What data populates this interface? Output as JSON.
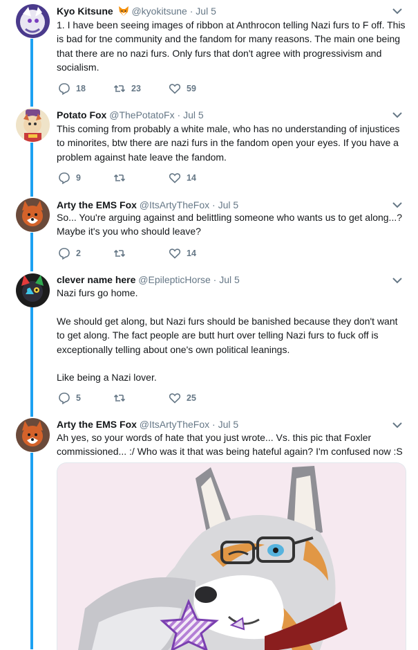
{
  "thread_color": "#1da1f2",
  "tweets": [
    {
      "name": "Kyo Kitsune",
      "name_emoji": "fox-face-emoji",
      "handle": "@kyokitsune",
      "date": "Jul 5",
      "body": [
        "1. I have been seeing images of ribbon at Anthrocon telling Nazi furs to F off. This is bad for tne community and the fandom for many reasons. The main one being that there are no nazi furs. Only furs that don't agree with progressivism and socialism."
      ],
      "replies": "18",
      "retweets": "23",
      "likes": "59"
    },
    {
      "name": "Potato Fox",
      "handle": "@ThePotatoFx",
      "date": "Jul 5",
      "body": [
        "This coming from probably a white male, who has no understanding of injustices to minorites, btw there are nazi furs in the fandom open your eyes. If you have a problem against hate leave the fandom."
      ],
      "replies": "9",
      "retweets": "",
      "likes": "14"
    },
    {
      "name": "Arty the EMS Fox",
      "handle": "@ItsArtyTheFox",
      "date": "Jul 5",
      "body": [
        "So... You're arguing against and belittling someone who wants us to get along...? Maybe it's you who should leave?"
      ],
      "replies": "2",
      "retweets": "",
      "likes": "14"
    },
    {
      "name": "clever name here",
      "handle": "@EpilepticHorse",
      "date": "Jul 5",
      "body": [
        "Nazi furs go home.",
        "We should get along, but Nazi furs should be banished because they don't want to get along. The fact people are butt hurt over telling Nazi furs to fuck off is exceptionally telling about one's own political leanings.",
        "Like being a Nazi lover."
      ],
      "replies": "5",
      "retweets": "",
      "likes": "25"
    },
    {
      "name": "Arty the EMS Fox",
      "handle": "@ItsArtyTheFox",
      "date": "Jul 5",
      "body": [
        "Ah yes, so your words of hate that you just wrote... Vs. this pic that Foxler commissioned... :/ Who was it that was being hateful again? I'm confused now :S"
      ],
      "media": "attached-image-fox-artwork"
    }
  ],
  "icons": {
    "reply": "reply-icon",
    "retweet": "retweet-icon",
    "like": "like-icon",
    "more": "chevron-down-icon"
  }
}
